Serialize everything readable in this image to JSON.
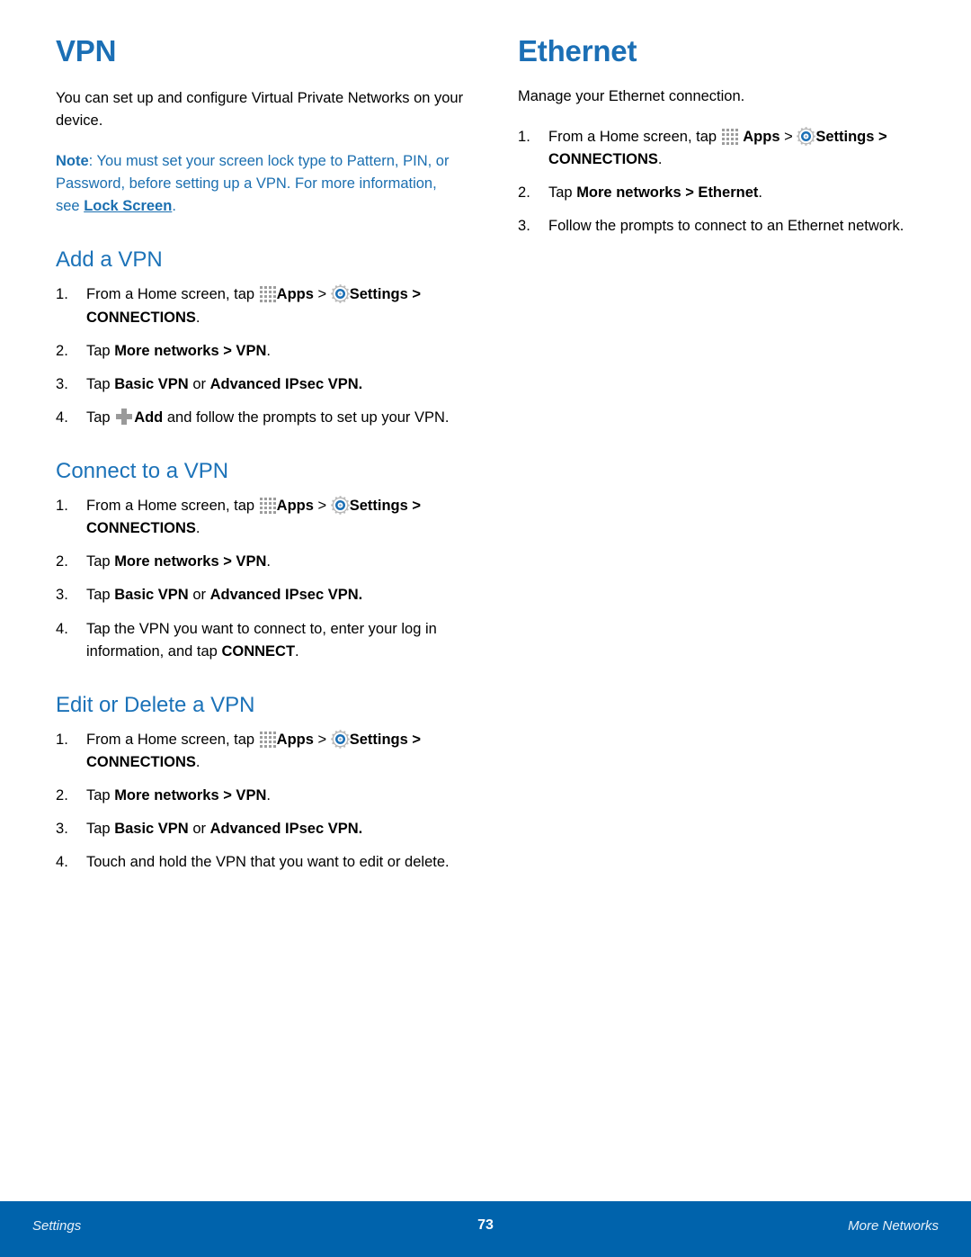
{
  "page": {
    "number": "73",
    "footer_left": "Settings",
    "footer_right": "More Networks",
    "accent_blue": "#1B6FB5",
    "footer_blue": "#0063AC",
    "note_blue": "#1B6FB0",
    "icon_gray": "#9c9c9c"
  },
  "left_column": {
    "title": "VPN",
    "intro": "You can set up and configure Virtual Private Networks on your device.",
    "note": {
      "label": "Note",
      "text_before_link": ": You must set your screen lock type to Pattern, PIN, or Password, before setting up a VPN. For more information, see ",
      "link_text": "Lock Screen",
      "text_after_link": "."
    },
    "sections": [
      {
        "heading": "Add a VPN",
        "steps": [
          {
            "parts": [
              {
                "type": "text",
                "text": "From a Home screen, tap "
              },
              {
                "type": "icon",
                "icon": "apps-grid-icon"
              },
              {
                "type": "bold",
                "text": "Apps"
              },
              {
                "type": "text",
                "text": "  > "
              },
              {
                "type": "icon",
                "icon": "settings-gear-icon"
              },
              {
                "type": "bold",
                "text": "Settings > CONNECTIONS"
              },
              {
                "type": "text",
                "text": "."
              }
            ]
          },
          {
            "parts": [
              {
                "type": "text",
                "text": "Tap "
              },
              {
                "type": "bold",
                "text": "More networks > VPN"
              },
              {
                "type": "text",
                "text": "."
              }
            ]
          },
          {
            "parts": [
              {
                "type": "text",
                "text": "Tap "
              },
              {
                "type": "bold",
                "text": "Basic VPN"
              },
              {
                "type": "text",
                "text": " or "
              },
              {
                "type": "bold",
                "text": "Advanced IPsec VPN."
              }
            ]
          },
          {
            "parts": [
              {
                "type": "text",
                "text": "Tap "
              },
              {
                "type": "icon",
                "icon": "plus-add-icon"
              },
              {
                "type": "bold",
                "text": "Add"
              },
              {
                "type": "text",
                "text": " and follow the prompts to set up your VPN."
              }
            ]
          }
        ]
      },
      {
        "heading": "Connect to a VPN",
        "steps": [
          {
            "parts": [
              {
                "type": "text",
                "text": "From a Home screen, tap "
              },
              {
                "type": "icon",
                "icon": "apps-grid-icon"
              },
              {
                "type": "bold",
                "text": "Apps"
              },
              {
                "type": "text",
                "text": "  > "
              },
              {
                "type": "icon",
                "icon": "settings-gear-icon"
              },
              {
                "type": "bold",
                "text": "Settings > CONNECTIONS"
              },
              {
                "type": "text",
                "text": "."
              }
            ]
          },
          {
            "parts": [
              {
                "type": "text",
                "text": "Tap "
              },
              {
                "type": "bold",
                "text": "More networks > VPN"
              },
              {
                "type": "text",
                "text": "."
              }
            ]
          },
          {
            "parts": [
              {
                "type": "text",
                "text": "Tap "
              },
              {
                "type": "bold",
                "text": "Basic VPN"
              },
              {
                "type": "text",
                "text": " or "
              },
              {
                "type": "bold",
                "text": "Advanced IPsec VPN."
              }
            ]
          },
          {
            "parts": [
              {
                "type": "text",
                "text": "Tap the VPN you want to connect to, enter your log in information, and tap "
              },
              {
                "type": "bold",
                "text": "CONNECT"
              },
              {
                "type": "text",
                "text": "."
              }
            ]
          }
        ]
      },
      {
        "heading": "Edit or Delete a VPN",
        "steps": [
          {
            "parts": [
              {
                "type": "text",
                "text": "From a Home screen, tap "
              },
              {
                "type": "icon",
                "icon": "apps-grid-icon"
              },
              {
                "type": "bold",
                "text": "Apps"
              },
              {
                "type": "text",
                "text": "  > "
              },
              {
                "type": "icon",
                "icon": "settings-gear-icon"
              },
              {
                "type": "bold",
                "text": "Settings > CONNECTIONS"
              },
              {
                "type": "text",
                "text": "."
              }
            ]
          },
          {
            "parts": [
              {
                "type": "text",
                "text": "Tap "
              },
              {
                "type": "bold",
                "text": "More networks > VPN"
              },
              {
                "type": "text",
                "text": "."
              }
            ]
          },
          {
            "parts": [
              {
                "type": "text",
                "text": "Tap "
              },
              {
                "type": "bold",
                "text": "Basic VPN"
              },
              {
                "type": "text",
                "text": " or "
              },
              {
                "type": "bold",
                "text": "Advanced IPsec VPN."
              }
            ]
          },
          {
            "parts": [
              {
                "type": "text",
                "text": "Touch and hold the VPN that you want to edit or delete."
              }
            ]
          }
        ]
      }
    ]
  },
  "right_column": {
    "title": "Ethernet",
    "intro": "Manage your Ethernet connection.",
    "sections": [
      {
        "heading": "",
        "steps": [
          {
            "parts": [
              {
                "type": "text",
                "text": "From a Home screen, tap "
              },
              {
                "type": "icon",
                "icon": "apps-grid-icon"
              },
              {
                "type": "text",
                "text": " "
              },
              {
                "type": "bold",
                "text": "Apps"
              },
              {
                "type": "text",
                "text": " > "
              },
              {
                "type": "icon",
                "icon": "settings-gear-icon"
              },
              {
                "type": "bold",
                "text": "Settings > CONNECTIONS"
              },
              {
                "type": "text",
                "text": "."
              }
            ]
          },
          {
            "parts": [
              {
                "type": "text",
                "text": "Tap "
              },
              {
                "type": "bold",
                "text": "More networks > Ethernet"
              },
              {
                "type": "text",
                "text": "."
              }
            ]
          },
          {
            "parts": [
              {
                "type": "text",
                "text": "Follow the prompts to connect to an Ethernet network."
              }
            ]
          }
        ]
      }
    ]
  }
}
